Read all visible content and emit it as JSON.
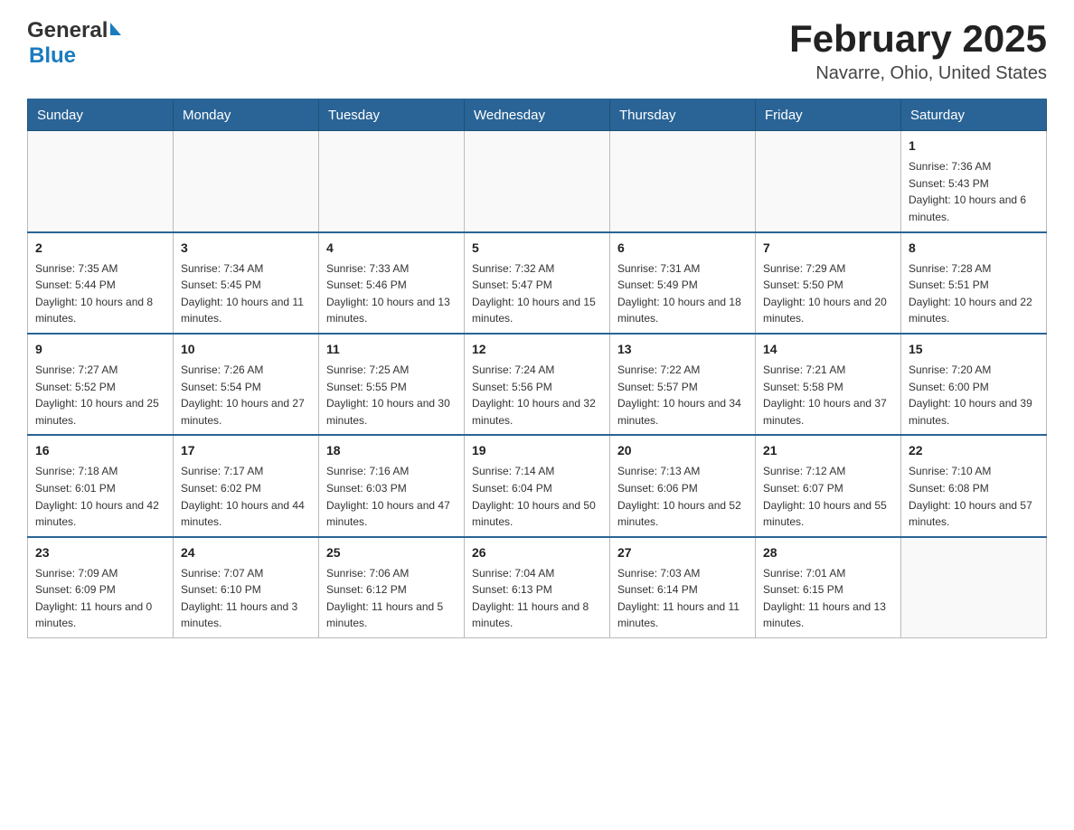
{
  "header": {
    "title": "February 2025",
    "subtitle": "Navarre, Ohio, United States"
  },
  "logo": {
    "line1": "General",
    "line2": "Blue"
  },
  "weekdays": [
    "Sunday",
    "Monday",
    "Tuesday",
    "Wednesday",
    "Thursday",
    "Friday",
    "Saturday"
  ],
  "weeks": [
    [
      {
        "day": "",
        "sunrise": "",
        "sunset": "",
        "daylight": ""
      },
      {
        "day": "",
        "sunrise": "",
        "sunset": "",
        "daylight": ""
      },
      {
        "day": "",
        "sunrise": "",
        "sunset": "",
        "daylight": ""
      },
      {
        "day": "",
        "sunrise": "",
        "sunset": "",
        "daylight": ""
      },
      {
        "day": "",
        "sunrise": "",
        "sunset": "",
        "daylight": ""
      },
      {
        "day": "",
        "sunrise": "",
        "sunset": "",
        "daylight": ""
      },
      {
        "day": "1",
        "sunrise": "Sunrise: 7:36 AM",
        "sunset": "Sunset: 5:43 PM",
        "daylight": "Daylight: 10 hours and 6 minutes."
      }
    ],
    [
      {
        "day": "2",
        "sunrise": "Sunrise: 7:35 AM",
        "sunset": "Sunset: 5:44 PM",
        "daylight": "Daylight: 10 hours and 8 minutes."
      },
      {
        "day": "3",
        "sunrise": "Sunrise: 7:34 AM",
        "sunset": "Sunset: 5:45 PM",
        "daylight": "Daylight: 10 hours and 11 minutes."
      },
      {
        "day": "4",
        "sunrise": "Sunrise: 7:33 AM",
        "sunset": "Sunset: 5:46 PM",
        "daylight": "Daylight: 10 hours and 13 minutes."
      },
      {
        "day": "5",
        "sunrise": "Sunrise: 7:32 AM",
        "sunset": "Sunset: 5:47 PM",
        "daylight": "Daylight: 10 hours and 15 minutes."
      },
      {
        "day": "6",
        "sunrise": "Sunrise: 7:31 AM",
        "sunset": "Sunset: 5:49 PM",
        "daylight": "Daylight: 10 hours and 18 minutes."
      },
      {
        "day": "7",
        "sunrise": "Sunrise: 7:29 AM",
        "sunset": "Sunset: 5:50 PM",
        "daylight": "Daylight: 10 hours and 20 minutes."
      },
      {
        "day": "8",
        "sunrise": "Sunrise: 7:28 AM",
        "sunset": "Sunset: 5:51 PM",
        "daylight": "Daylight: 10 hours and 22 minutes."
      }
    ],
    [
      {
        "day": "9",
        "sunrise": "Sunrise: 7:27 AM",
        "sunset": "Sunset: 5:52 PM",
        "daylight": "Daylight: 10 hours and 25 minutes."
      },
      {
        "day": "10",
        "sunrise": "Sunrise: 7:26 AM",
        "sunset": "Sunset: 5:54 PM",
        "daylight": "Daylight: 10 hours and 27 minutes."
      },
      {
        "day": "11",
        "sunrise": "Sunrise: 7:25 AM",
        "sunset": "Sunset: 5:55 PM",
        "daylight": "Daylight: 10 hours and 30 minutes."
      },
      {
        "day": "12",
        "sunrise": "Sunrise: 7:24 AM",
        "sunset": "Sunset: 5:56 PM",
        "daylight": "Daylight: 10 hours and 32 minutes."
      },
      {
        "day": "13",
        "sunrise": "Sunrise: 7:22 AM",
        "sunset": "Sunset: 5:57 PM",
        "daylight": "Daylight: 10 hours and 34 minutes."
      },
      {
        "day": "14",
        "sunrise": "Sunrise: 7:21 AM",
        "sunset": "Sunset: 5:58 PM",
        "daylight": "Daylight: 10 hours and 37 minutes."
      },
      {
        "day": "15",
        "sunrise": "Sunrise: 7:20 AM",
        "sunset": "Sunset: 6:00 PM",
        "daylight": "Daylight: 10 hours and 39 minutes."
      }
    ],
    [
      {
        "day": "16",
        "sunrise": "Sunrise: 7:18 AM",
        "sunset": "Sunset: 6:01 PM",
        "daylight": "Daylight: 10 hours and 42 minutes."
      },
      {
        "day": "17",
        "sunrise": "Sunrise: 7:17 AM",
        "sunset": "Sunset: 6:02 PM",
        "daylight": "Daylight: 10 hours and 44 minutes."
      },
      {
        "day": "18",
        "sunrise": "Sunrise: 7:16 AM",
        "sunset": "Sunset: 6:03 PM",
        "daylight": "Daylight: 10 hours and 47 minutes."
      },
      {
        "day": "19",
        "sunrise": "Sunrise: 7:14 AM",
        "sunset": "Sunset: 6:04 PM",
        "daylight": "Daylight: 10 hours and 50 minutes."
      },
      {
        "day": "20",
        "sunrise": "Sunrise: 7:13 AM",
        "sunset": "Sunset: 6:06 PM",
        "daylight": "Daylight: 10 hours and 52 minutes."
      },
      {
        "day": "21",
        "sunrise": "Sunrise: 7:12 AM",
        "sunset": "Sunset: 6:07 PM",
        "daylight": "Daylight: 10 hours and 55 minutes."
      },
      {
        "day": "22",
        "sunrise": "Sunrise: 7:10 AM",
        "sunset": "Sunset: 6:08 PM",
        "daylight": "Daylight: 10 hours and 57 minutes."
      }
    ],
    [
      {
        "day": "23",
        "sunrise": "Sunrise: 7:09 AM",
        "sunset": "Sunset: 6:09 PM",
        "daylight": "Daylight: 11 hours and 0 minutes."
      },
      {
        "day": "24",
        "sunrise": "Sunrise: 7:07 AM",
        "sunset": "Sunset: 6:10 PM",
        "daylight": "Daylight: 11 hours and 3 minutes."
      },
      {
        "day": "25",
        "sunrise": "Sunrise: 7:06 AM",
        "sunset": "Sunset: 6:12 PM",
        "daylight": "Daylight: 11 hours and 5 minutes."
      },
      {
        "day": "26",
        "sunrise": "Sunrise: 7:04 AM",
        "sunset": "Sunset: 6:13 PM",
        "daylight": "Daylight: 11 hours and 8 minutes."
      },
      {
        "day": "27",
        "sunrise": "Sunrise: 7:03 AM",
        "sunset": "Sunset: 6:14 PM",
        "daylight": "Daylight: 11 hours and 11 minutes."
      },
      {
        "day": "28",
        "sunrise": "Sunrise: 7:01 AM",
        "sunset": "Sunset: 6:15 PM",
        "daylight": "Daylight: 11 hours and 13 minutes."
      },
      {
        "day": "",
        "sunrise": "",
        "sunset": "",
        "daylight": ""
      }
    ]
  ]
}
